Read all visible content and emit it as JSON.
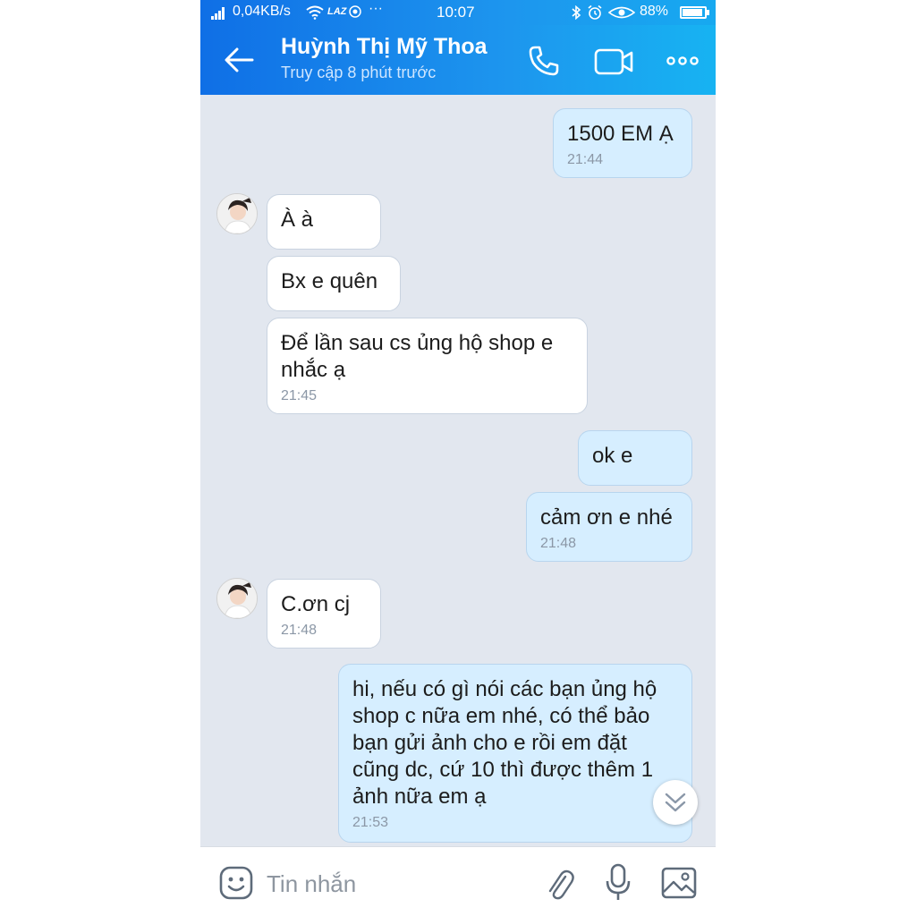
{
  "status_bar": {
    "network_speed": "0,04KB/s",
    "carrier_icon": "LAZ",
    "dots": "···",
    "time": "10:07",
    "battery": "88%",
    "icons": [
      "signal-icon",
      "wifi-icon",
      "bluetooth-icon",
      "alarm-icon",
      "eye-icon",
      "battery-icon"
    ]
  },
  "header": {
    "contact_name": "Huỳnh Thị Mỹ Thoa",
    "contact_status": "Truy cập 8 phút trước",
    "icons": [
      "back-arrow-icon",
      "phone-icon",
      "video-camera-icon",
      "more-dots-icon"
    ]
  },
  "messages": [
    {
      "direction": "out",
      "text": "1500 EM Ạ",
      "time": "21:44"
    },
    {
      "direction": "in",
      "text": "À à",
      "time": ""
    },
    {
      "direction": "in",
      "text": "Bx e quên",
      "time": ""
    },
    {
      "direction": "in",
      "text": "Để lần sau cs ủng hộ shop e nhắc ạ",
      "time": "21:45"
    },
    {
      "direction": "out",
      "text": "ok e",
      "time": ""
    },
    {
      "direction": "out",
      "text": "cảm ơn e nhé",
      "time": "21:48"
    },
    {
      "direction": "in",
      "text": "C.ơn cj",
      "time": "21:48"
    },
    {
      "direction": "out",
      "text": "hi, nếu có gì nói các bạn ủng hộ shop c nữa em nhé, có thể bảo bạn gửi ảnh cho e rồi em đặt cũng dc, cứ 10 thì được thêm 1 ảnh nữa em ạ",
      "time": "21:53"
    }
  ],
  "input": {
    "placeholder": "Tin nhắn",
    "icons": [
      "emoji-icon",
      "paperclip-icon",
      "microphone-icon",
      "image-icon",
      "chevron-double-down-icon"
    ]
  },
  "colors": {
    "header_start": "#0f6fe6",
    "header_end": "#17b3f2",
    "chat_background": "#e2e7ef",
    "outgoing_bubble": "#d6eeff",
    "incoming_bubble": "#ffffff"
  }
}
